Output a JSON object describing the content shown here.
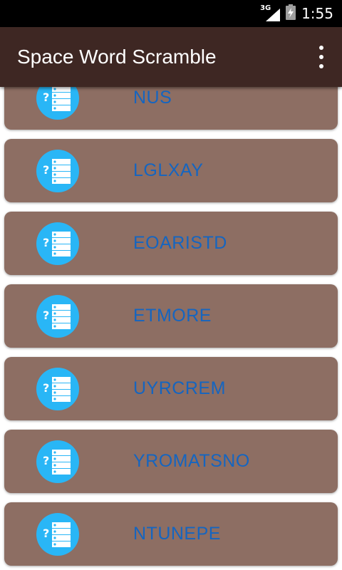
{
  "status_bar": {
    "network": "3G",
    "time": "1:55"
  },
  "app_bar": {
    "title": "Space Word Scramble",
    "menu_icon": "overflow-menu-icon"
  },
  "colors": {
    "app_bar_bg": "#3e2723",
    "card_bg": "#8d6e63",
    "icon_bg": "#29b6f6",
    "word_text": "#1565c0"
  },
  "list": {
    "icon": "quiz-list-icon",
    "items": [
      {
        "word": "NUS"
      },
      {
        "word": "LGLXAY"
      },
      {
        "word": "EOARISTD"
      },
      {
        "word": "ETMORE"
      },
      {
        "word": "UYRCREM"
      },
      {
        "word": "YROMATSNO"
      },
      {
        "word": "NTUNEPE"
      }
    ]
  }
}
